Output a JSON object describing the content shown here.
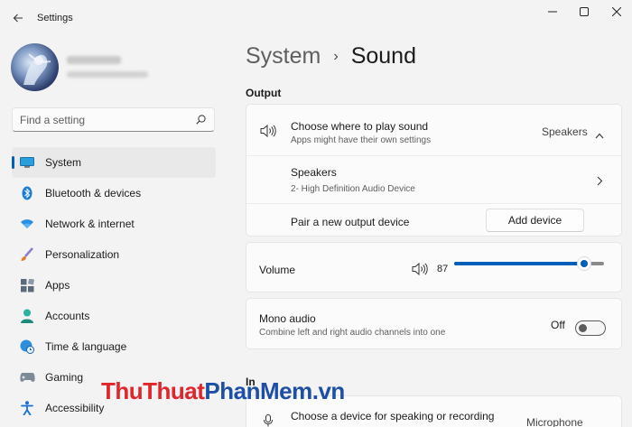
{
  "window": {
    "title": "Settings",
    "back_icon": "arrow-left-icon",
    "minimize_icon": "minimize-icon",
    "maximize_icon": "maximize-icon",
    "close_icon": "close-icon"
  },
  "user": {
    "avatar_icon": "user-avatar"
  },
  "search": {
    "placeholder": "Find a setting",
    "value": "",
    "icon": "search-icon"
  },
  "sidebar": {
    "items": [
      {
        "label": "System",
        "icon": "monitor-icon",
        "active": true
      },
      {
        "label": "Bluetooth & devices",
        "icon": "bluetooth-icon"
      },
      {
        "label": "Network & internet",
        "icon": "wifi-icon"
      },
      {
        "label": "Personalization",
        "icon": "brush-icon"
      },
      {
        "label": "Apps",
        "icon": "apps-icon"
      },
      {
        "label": "Accounts",
        "icon": "person-icon"
      },
      {
        "label": "Time & language",
        "icon": "globe-clock-icon"
      },
      {
        "label": "Gaming",
        "icon": "gamepad-icon"
      },
      {
        "label": "Accessibility",
        "icon": "accessibility-icon"
      }
    ]
  },
  "breadcrumb": {
    "parent": "System",
    "separator": "›",
    "current": "Sound"
  },
  "output": {
    "section_label": "Output",
    "choose": {
      "title": "Choose where to play sound",
      "subtitle": "Apps might have their own settings",
      "value": "Speakers",
      "icon": "speaker-icon",
      "expand_icon": "chevron-up-icon"
    },
    "device": {
      "title": "Speakers",
      "subtitle": "2- High Definition Audio Device",
      "icon": "chevron-right-icon"
    },
    "pair": {
      "label": "Pair a new output device",
      "button": "Add device"
    },
    "volume": {
      "label": "Volume",
      "value": "87",
      "level": 0.87,
      "icon": "speaker-icon"
    },
    "mono": {
      "title": "Mono audio",
      "subtitle": "Combine left and right audio channels into one",
      "state": "Off",
      "on": false
    }
  },
  "input": {
    "section_label": "In",
    "choose": {
      "title": "Choose a device for speaking or recording",
      "value": "Microphone",
      "icon": "microphone-icon"
    }
  },
  "watermark": {
    "part1": "ThuThuat",
    "part2": "PhanMem",
    "part3": ".vn",
    "color1": "#e0262b",
    "color2": "#1d4fa6"
  },
  "colors": {
    "accent": "#005fb8",
    "background": "#f3f3f3",
    "card": "#fbfbfb"
  }
}
